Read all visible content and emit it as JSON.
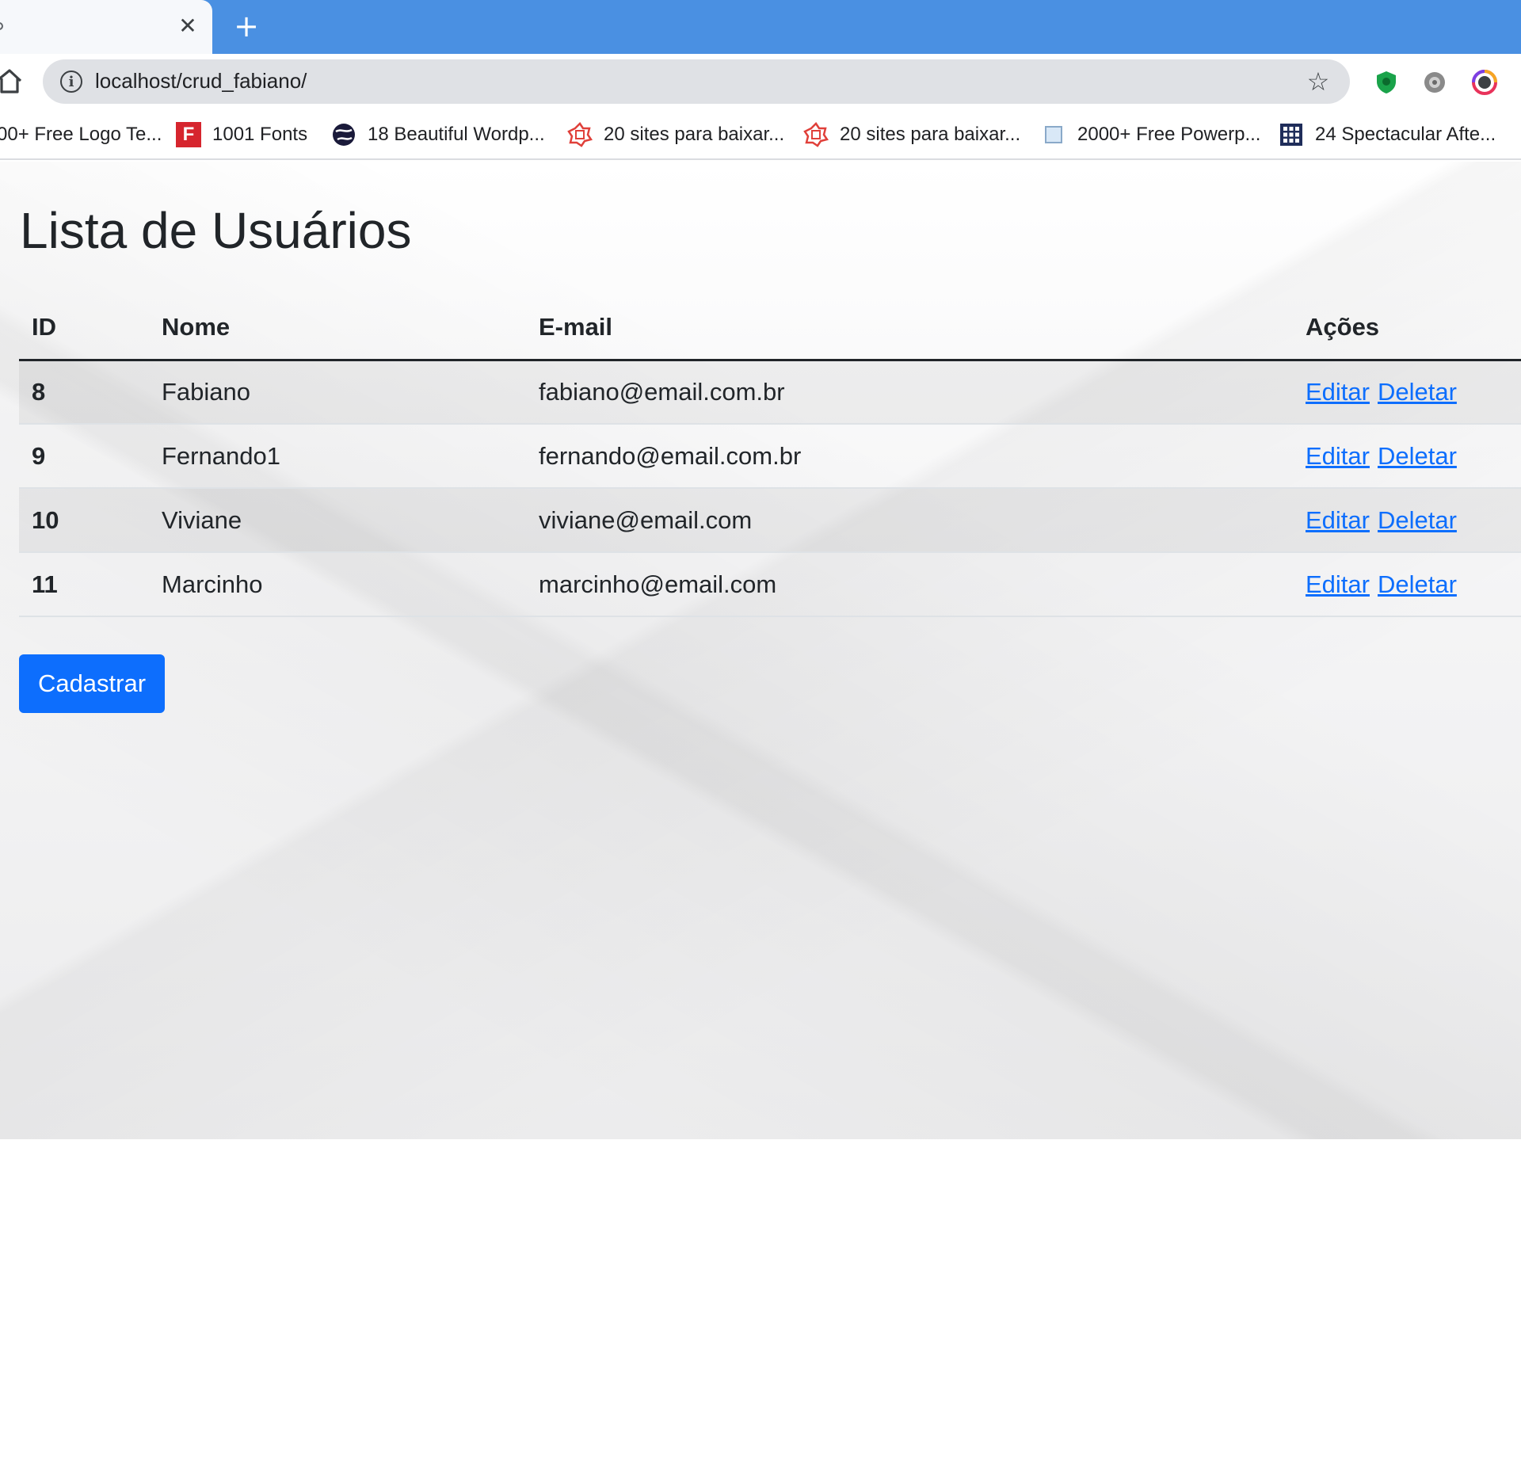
{
  "browser": {
    "tab_close_glyph": "✕",
    "new_tab_glyph": "+",
    "url": "localhost/crud_fabiano/",
    "info_glyph": "i",
    "star_glyph": "☆",
    "bookmarks": [
      {
        "label": "00+ Free Logo Te...",
        "icon": "generic-site-icon"
      },
      {
        "label": "1001 Fonts",
        "icon": "fonts-f-icon"
      },
      {
        "label": "18 Beautiful Wordp...",
        "icon": "globe-icon"
      },
      {
        "label": "20 sites para baixar...",
        "icon": "red-badge-icon"
      },
      {
        "label": "20 sites para baixar...",
        "icon": "red-badge-icon"
      },
      {
        "label": "2000+ Free Powerp...",
        "icon": "blank-page-icon"
      },
      {
        "label": "24 Spectacular Afte...",
        "icon": "grid-icon"
      }
    ],
    "fonts_icon_letter": "F"
  },
  "page": {
    "title": "Lista de Usuários",
    "table": {
      "headers": {
        "id": "ID",
        "nome": "Nome",
        "email": "E-mail",
        "acoes": "Ações"
      },
      "rows": [
        {
          "id": "8",
          "nome": "Fabiano",
          "email": "fabiano@email.com.br",
          "edit": "Editar",
          "delete": "Deletar"
        },
        {
          "id": "9",
          "nome": "Fernando1",
          "email": "fernando@email.com.br",
          "edit": "Editar",
          "delete": "Deletar"
        },
        {
          "id": "10",
          "nome": "Viviane",
          "email": "viviane@email.com",
          "edit": "Editar",
          "delete": "Deletar"
        },
        {
          "id": "11",
          "nome": "Marcinho",
          "email": "marcinho@email.com",
          "edit": "Editar",
          "delete": "Deletar"
        }
      ]
    },
    "register_button": "Cadastrar"
  },
  "colors": {
    "tabstrip": "#4a90e2",
    "primary": "#0d6efd",
    "text": "#212529"
  }
}
